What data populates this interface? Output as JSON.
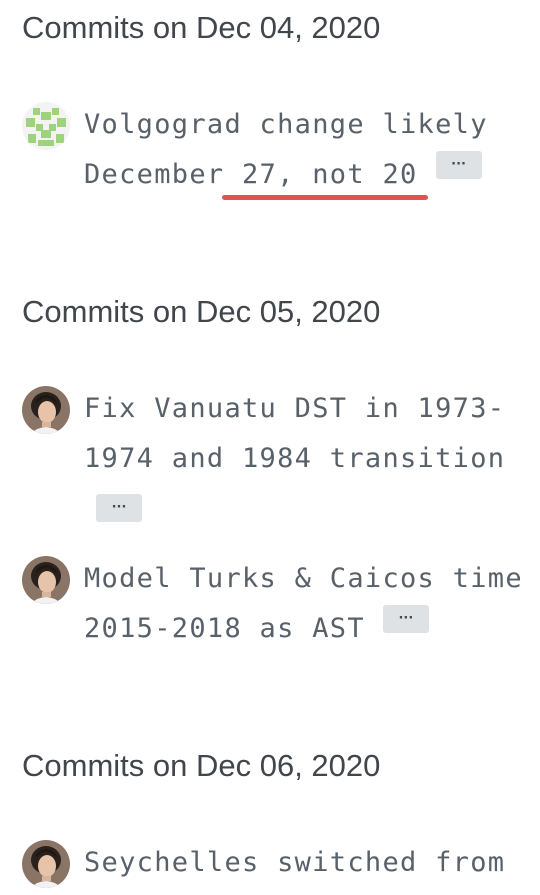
{
  "groups": [
    {
      "heading": "Commits on Dec 04, 2020",
      "commits": [
        {
          "message": "Volgograd change likely December 27, not 20",
          "more_label": "···",
          "avatar": "identicon-green"
        }
      ]
    },
    {
      "heading": "Commits on Dec 05, 2020",
      "commits": [
        {
          "message": "Fix Vanuatu DST in 1973-1974 and 1984 transition",
          "more_label": "···",
          "avatar": "user-photo"
        },
        {
          "message": "Model Turks & Caicos time 2015-2018 as AST",
          "more_label": "···",
          "avatar": "user-photo"
        }
      ]
    },
    {
      "heading": "Commits on Dec 06, 2020",
      "commits": [
        {
          "message": "Seychelles switched from",
          "avatar": "user-photo"
        }
      ]
    }
  ],
  "colors": {
    "heading": "#40464c",
    "message": "#586069",
    "button_bg": "#dfe2e5",
    "annotation_underline": "#e05353"
  }
}
